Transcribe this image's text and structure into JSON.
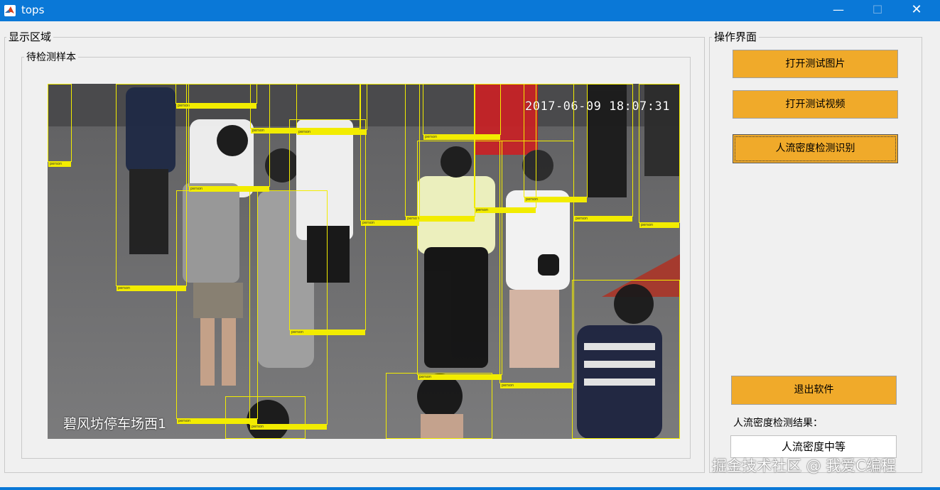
{
  "window": {
    "title": "tops",
    "minimize": "—",
    "maximize": "☐",
    "close": "✕"
  },
  "display_panel": {
    "title": "显示区域"
  },
  "sample_panel": {
    "title": "待检测样本"
  },
  "video": {
    "timestamp": "2017-06-09 18:07:31",
    "location": "碧风坊停车场西1",
    "box_color": "#f2ec00",
    "detection_label": "person"
  },
  "controls_panel": {
    "title": "操作界面"
  },
  "buttons": {
    "open_image": "打开测试图片",
    "open_video": "打开测试视频",
    "detect": "人流密度检测识别",
    "exit": "退出软件",
    "color": "#f0aa2a"
  },
  "result": {
    "label": "人流密度检测结果：",
    "value": "人流密度中等"
  },
  "watermark": "掘金技术社区 @ 我爱C编程"
}
